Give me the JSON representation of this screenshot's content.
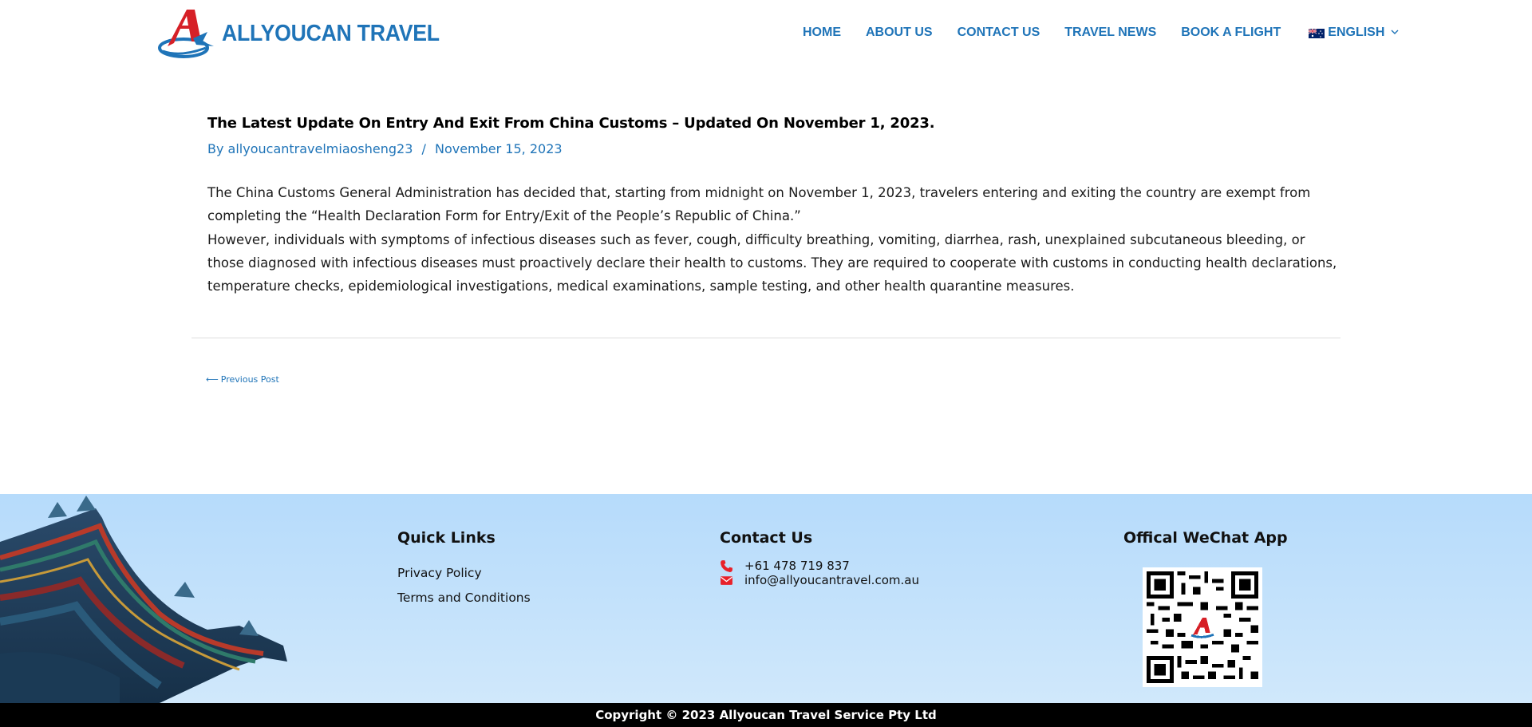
{
  "header": {
    "logo_text": "ALLYOUCAN TRAVEL",
    "nav": [
      {
        "label": "HOME"
      },
      {
        "label": "ABOUT US"
      },
      {
        "label": "CONTACT US"
      },
      {
        "label": "TRAVEL NEWS"
      },
      {
        "label": "BOOK A FLIGHT"
      }
    ],
    "language": {
      "label": "ENGLISH",
      "flag_icon": "australia-flag-icon"
    }
  },
  "post": {
    "title": "The Latest Update On Entry And Exit From China Customs – Updated On November 1, 2023.",
    "meta_prefix": "By",
    "author": "allyoucantravelmiaosheng23",
    "meta_separator": "/",
    "date": "November 15, 2023",
    "paragraphs": [
      "The China Customs General Administration has decided that, starting from midnight on November 1, 2023, travelers entering and exiting the country are exempt from completing the “Health Declaration Form for Entry/Exit of the People’s Republic of China.”",
      "However, individuals with symptoms of infectious diseases such as fever, cough, difficulty breathing, vomiting, diarrhea, rash, unexplained subcutaneous bleeding, or those diagnosed with infectious diseases must proactively declare their health to customs. They are required to cooperate with customs in conducting health declarations, temperature checks, epidemiological investigations, medical examinations, sample testing, and other health quarantine measures."
    ],
    "previous_post_label": "Previous Post"
  },
  "footer": {
    "quick_links": {
      "heading": "Quick Links",
      "links": [
        "Privacy Policy",
        "Terms and Conditions"
      ]
    },
    "contact": {
      "heading": "Contact Us",
      "phone": "+61 478 719 837",
      "email": "info@allyoucantravel.com.au"
    },
    "wechat": {
      "heading": "Offical WeChat App"
    },
    "copyright": "Copyright © 2023 Allyoucan Travel Service Pty Ltd"
  },
  "colors": {
    "brand_blue": "#1f74b8",
    "logo_red": "#d62027",
    "footer_bg": "#b6dbfb",
    "icon_red": "#e8212a"
  }
}
